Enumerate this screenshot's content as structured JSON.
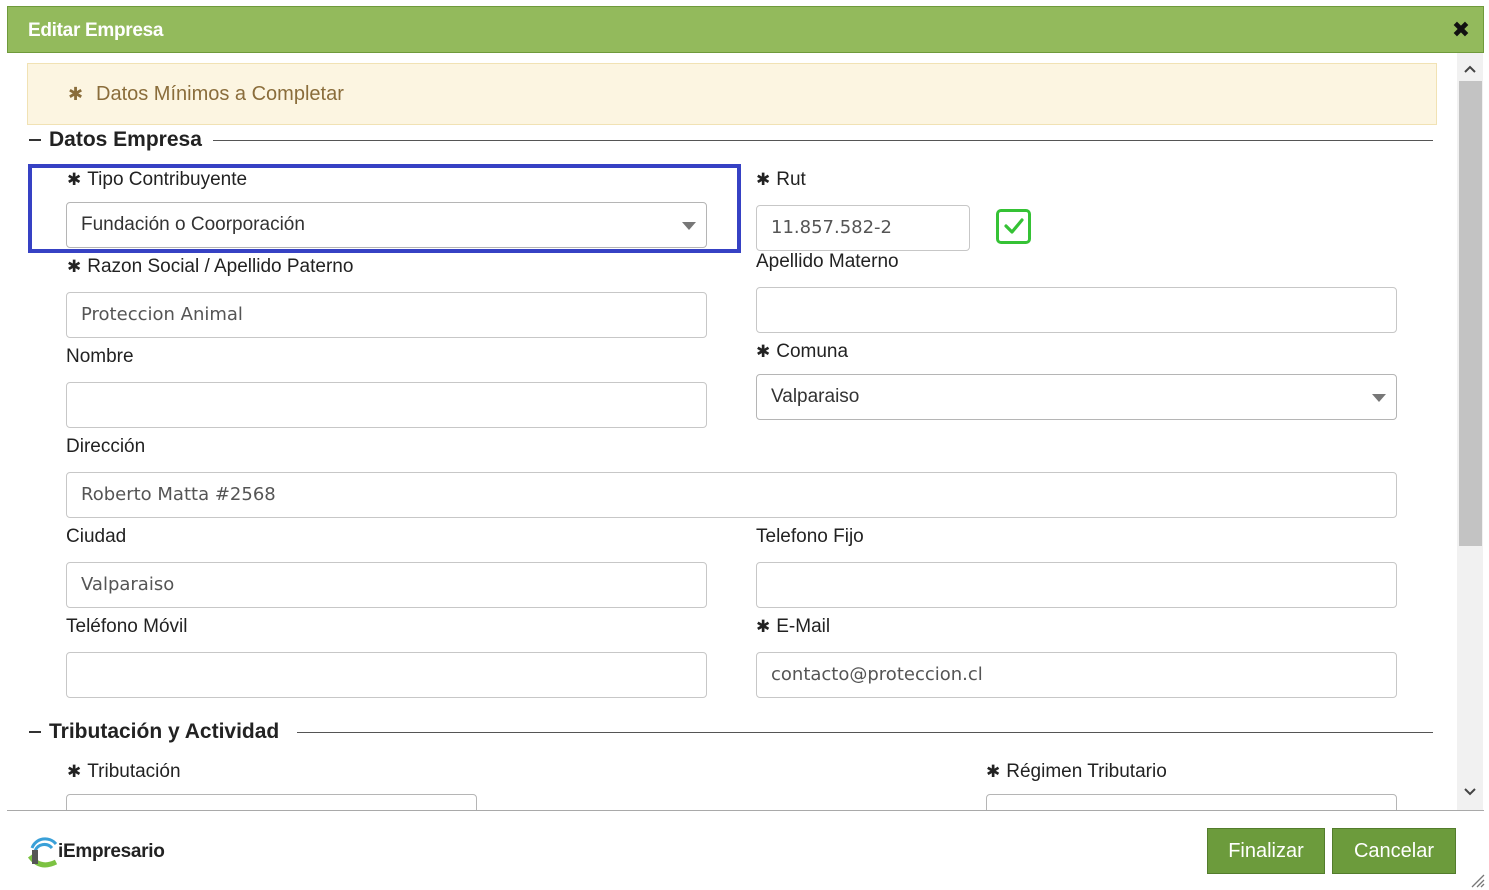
{
  "dialog": {
    "title": "Editar Empresa",
    "close_icon": "close-icon"
  },
  "notice": {
    "text": "Datos Mínimos a Completar",
    "star": "✱"
  },
  "sections": {
    "company": "Datos Empresa",
    "tax": "Tributación y Actividad"
  },
  "fields": {
    "tipo": {
      "label": "Tipo Contribuyente",
      "value": "Fundación o Coorporación"
    },
    "rut": {
      "label": "Rut",
      "value": "11.857.582-2",
      "validated": true
    },
    "razon": {
      "label": "Razon Social / Apellido Paterno",
      "value": "Proteccion Animal"
    },
    "materno": {
      "label": "Apellido Materno",
      "value": ""
    },
    "nombre": {
      "label": "Nombre",
      "value": ""
    },
    "comuna": {
      "label": "Comuna",
      "value": "Valparaiso"
    },
    "direccion": {
      "label": "Dirección",
      "value": "Roberto Matta #2568"
    },
    "ciudad": {
      "label": "Ciudad",
      "value": "Valparaiso"
    },
    "fijo": {
      "label": "Telefono Fijo",
      "value": ""
    },
    "movil": {
      "label": "Teléfono Móvil",
      "value": ""
    },
    "email": {
      "label": "E-Mail",
      "value": "contacto@proteccion.cl"
    },
    "tributacion": {
      "label": "Tributación"
    },
    "regimen": {
      "label": "Régimen Tributario"
    }
  },
  "footer": {
    "logo_text": "iEmpresario",
    "finalize": "Finalizar",
    "cancel": "Cancelar"
  },
  "colors": {
    "header": "#93ba5c",
    "button": "#6c9b3c",
    "highlight": "#3641c4",
    "check": "#35c235",
    "notice_bg": "#fcf5e1"
  }
}
